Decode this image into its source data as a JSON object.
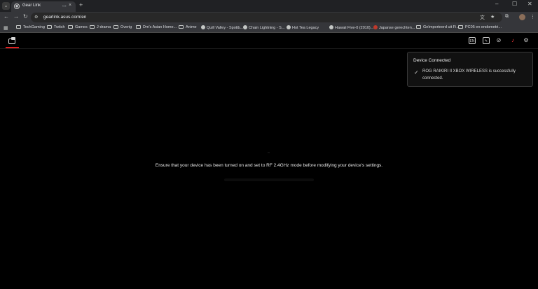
{
  "browser": {
    "search_tabs_icon": "chevron-down-icon",
    "tab": {
      "title": "Gear Link",
      "close": "×"
    },
    "new_tab": "+",
    "window": {
      "minimize": "–",
      "maximize": "☐",
      "close": "✕"
    }
  },
  "toolbar": {
    "back": "←",
    "forward": "→",
    "reload": "↻",
    "url": "gearlink.asus.com/en"
  },
  "bookmarks": [
    {
      "label": "TechGaming",
      "kind": "folder"
    },
    {
      "label": "Twitch",
      "kind": "folder"
    },
    {
      "label": "Games",
      "kind": "folder"
    },
    {
      "label": "J-drama",
      "kind": "folder"
    },
    {
      "label": "Overig",
      "kind": "folder"
    },
    {
      "label": "Dm's Asian Home...",
      "kind": "folder"
    },
    {
      "label": "Anime",
      "kind": "folder"
    },
    {
      "label": "Quill Valley - Spotib...",
      "kind": "site"
    },
    {
      "label": "Chain Lightning - S...",
      "kind": "site"
    },
    {
      "label": "Hot Tea Legacy",
      "kind": "site"
    },
    {
      "label": "Hawaii Five-0 (2010)...",
      "kind": "site"
    },
    {
      "label": "Japanse gerechten...",
      "kind": "site-red"
    },
    {
      "label": "Geïmporteerd uit Fi...",
      "kind": "folder"
    },
    {
      "label": "PC05 en endometri...",
      "kind": "folder"
    }
  ],
  "toast": {
    "title": "Device Connected",
    "message": "ROG RAIKIRI II XBOX WIRELESS is successfully connected."
  },
  "main": {
    "message": "Ensure that your device has been turned on and set to RF 2.4GHz mode before modifying your device's settings."
  },
  "colors": {
    "background": "#000000",
    "accent": "#e02020",
    "chrome_dark": "#202124",
    "chrome_toolbar": "#35363a"
  }
}
